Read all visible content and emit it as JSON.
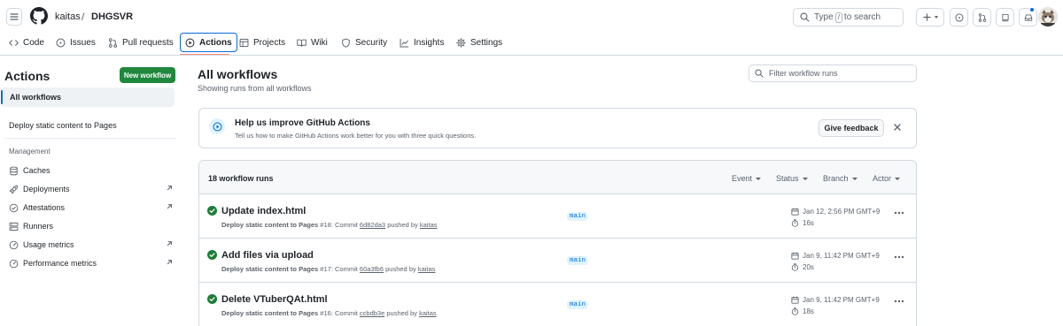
{
  "header": {
    "owner": "kaitas",
    "separator": "/",
    "repo": "DHGSVR",
    "search_prefix": "Type",
    "search_key": "/",
    "search_suffix": "to search",
    "avatar_colors": {
      "bg": "#e9e4de"
    }
  },
  "nav": {
    "tabs": [
      {
        "label": "Code",
        "icon": "code-icon"
      },
      {
        "label": "Issues",
        "icon": "issue-icon"
      },
      {
        "label": "Pull requests",
        "icon": "pull-request-icon"
      },
      {
        "label": "Actions",
        "icon": "play-icon"
      },
      {
        "label": "Projects",
        "icon": "table-icon"
      },
      {
        "label": "Wiki",
        "icon": "book-icon"
      },
      {
        "label": "Security",
        "icon": "shield-icon"
      },
      {
        "label": "Insights",
        "icon": "graph-icon"
      },
      {
        "label": "Settings",
        "icon": "gear-icon"
      }
    ],
    "active": "Actions",
    "accent": "#0969da",
    "underline_color": "#fd8c73"
  },
  "sidebar": {
    "title": "Actions",
    "new_workflow_label": "New workflow",
    "all_workflows_label": "All workflows",
    "workflow": "Deploy static content to Pages",
    "management_heading": "Management",
    "management_items": [
      {
        "label": "Caches",
        "icon": "database-icon",
        "external": false
      },
      {
        "label": "Deployments",
        "icon": "rocket-icon",
        "external": true
      },
      {
        "label": "Attestations",
        "icon": "verified-icon",
        "external": true
      },
      {
        "label": "Runners",
        "icon": "server-icon",
        "external": false
      },
      {
        "label": "Usage metrics",
        "icon": "meter-icon",
        "external": true
      },
      {
        "label": "Performance metrics",
        "icon": "meter-icon",
        "external": true
      }
    ]
  },
  "main": {
    "title": "All workflows",
    "subtitle": "Showing runs from all workflows",
    "filter_placeholder": "Filter workflow runs"
  },
  "banner": {
    "title": "Help us improve GitHub Actions",
    "text": "Tell us how to make GitHub Actions work better for you with three quick questions.",
    "feedback_label": "Give feedback"
  },
  "runs": {
    "count_label": "18 workflow runs",
    "filters": [
      "Event",
      "Status",
      "Branch",
      "Actor"
    ],
    "success_color": "#1a7f37",
    "items": [
      {
        "title": "Update index.html",
        "workflow": "Deploy static content to Pages",
        "run_number": "#18",
        "commit_prefix": ": Commit",
        "commit": "6d82da3",
        "pushed_by": "pushed by",
        "author": "kaitas",
        "branch": "main",
        "date": "Jan 12, 2:56 PM GMT+9",
        "duration": "16s"
      },
      {
        "title": "Add files via upload",
        "workflow": "Deploy static content to Pages",
        "run_number": "#17",
        "commit_prefix": ": Commit",
        "commit": "60a3fb6",
        "pushed_by": "pushed by",
        "author": "kaitas",
        "branch": "main",
        "date": "Jan 9, 11:42 PM GMT+9",
        "duration": "20s"
      },
      {
        "title": "Delete VTuberQAt.html",
        "workflow": "Deploy static content to Pages",
        "run_number": "#16",
        "commit_prefix": ": Commit",
        "commit": "ccbdb3e",
        "pushed_by": "pushed by",
        "author": "kaitas",
        "branch": "main",
        "date": "Jan 9, 11:42 PM GMT+9",
        "duration": "18s"
      }
    ]
  }
}
